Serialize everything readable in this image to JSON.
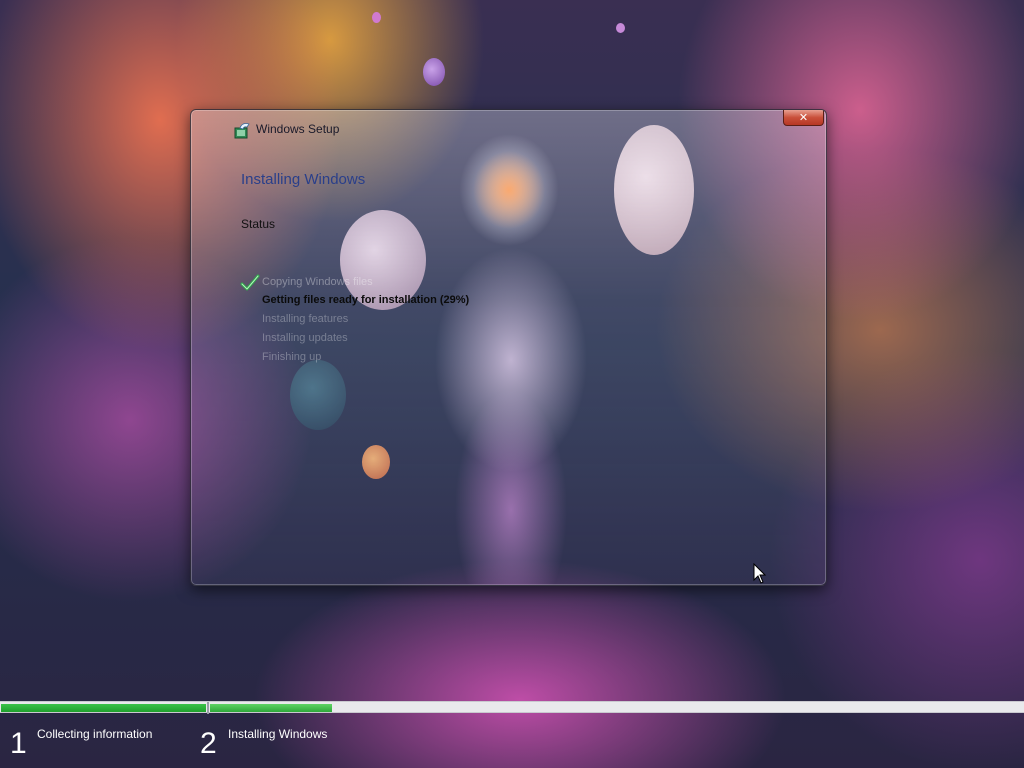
{
  "window": {
    "title": "Windows Setup",
    "close_symbol": "✕",
    "page_title": "Installing Windows",
    "status_heading": "Status",
    "steps": [
      {
        "label": "Copying Windows files",
        "state": "done"
      },
      {
        "label": "Getting files ready for installation (29%)",
        "state": "active"
      },
      {
        "label": "Installing features",
        "state": "pending"
      },
      {
        "label": "Installing updates",
        "state": "pending"
      },
      {
        "label": "Finishing up",
        "state": "pending"
      }
    ]
  },
  "progress": {
    "phases": [
      {
        "number": "1",
        "label": "Collecting information",
        "fill_fraction": 1.0
      },
      {
        "number": "2",
        "label": "Installing Windows",
        "fill_fraction": 0.15
      }
    ]
  },
  "colors": {
    "accent_green": "#1fa02d",
    "title_blue": "#2a3f8a",
    "close_red": "#c9503b"
  },
  "icons": {
    "title": "windows-setup-icon",
    "done_step": "checkmark-icon",
    "close": "close-icon",
    "cursor": "mouse-pointer-icon"
  }
}
